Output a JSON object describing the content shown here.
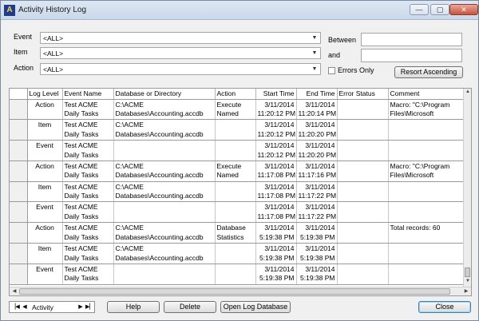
{
  "window": {
    "title": "Activity History Log",
    "icon": "access-app-icon",
    "controls": {
      "minimize": "—",
      "maximize": "▢",
      "close": "✕"
    }
  },
  "filters": {
    "event_label": "Event",
    "item_label": "Item",
    "action_label": "Action",
    "event_value": "<ALL>",
    "item_value": "<ALL>",
    "action_value": "<ALL>",
    "between_label": "Between",
    "and_label": "and",
    "between_value": "",
    "and_value": "",
    "errors_only_label": "Errors Only",
    "errors_only_checked": false,
    "resort_button": "Resort Ascending"
  },
  "table": {
    "columns": [
      "Log Level",
      "Event Name",
      "Database or Directory",
      "Action",
      "Start Time",
      "End Time",
      "Error Status",
      "Comment"
    ],
    "rows": [
      {
        "level": "Action",
        "event1": "Test ACME",
        "event2": "Daily Tasks",
        "db1": "C:\\ACME",
        "db2": "Databases\\Accounting.accdb",
        "action1": "Execute",
        "action2": "Named",
        "start1": "3/11/2014",
        "start2": "11:20:12 PM",
        "end1": "3/11/2014",
        "end2": "11:20:14 PM",
        "error": "",
        "comment1": "Macro: \"C:\\Program",
        "comment2": "Files\\Microsoft"
      },
      {
        "level": "Item",
        "event1": "Test ACME",
        "event2": "Daily Tasks",
        "db1": "C:\\ACME",
        "db2": "Databases\\Accounting.accdb",
        "action1": "",
        "action2": "",
        "start1": "3/11/2014",
        "start2": "11:20:12 PM",
        "end1": "3/11/2014",
        "end2": "11:20:20 PM",
        "error": "",
        "comment1": "",
        "comment2": ""
      },
      {
        "level": "Event",
        "event1": "Test ACME",
        "event2": "Daily Tasks",
        "db1": "",
        "db2": "",
        "action1": "",
        "action2": "",
        "start1": "3/11/2014",
        "start2": "11:20:12 PM",
        "end1": "3/11/2014",
        "end2": "11:20:20 PM",
        "error": "",
        "comment1": "",
        "comment2": ""
      },
      {
        "level": "Action",
        "event1": "Test ACME",
        "event2": "Daily Tasks",
        "db1": "C:\\ACME",
        "db2": "Databases\\Accounting.accdb",
        "action1": "Execute",
        "action2": "Named",
        "start1": "3/11/2014",
        "start2": "11:17:08 PM",
        "end1": "3/11/2014",
        "end2": "11:17:16 PM",
        "error": "",
        "comment1": "Macro: \"C:\\Program",
        "comment2": "Files\\Microsoft"
      },
      {
        "level": "Item",
        "event1": "Test ACME",
        "event2": "Daily Tasks",
        "db1": "C:\\ACME",
        "db2": "Databases\\Accounting.accdb",
        "action1": "",
        "action2": "",
        "start1": "3/11/2014",
        "start2": "11:17:08 PM",
        "end1": "3/11/2014",
        "end2": "11:17:22 PM",
        "error": "",
        "comment1": "",
        "comment2": ""
      },
      {
        "level": "Event",
        "event1": "Test ACME",
        "event2": "Daily Tasks",
        "db1": "",
        "db2": "",
        "action1": "",
        "action2": "",
        "start1": "3/11/2014",
        "start2": "11:17:08 PM",
        "end1": "3/11/2014",
        "end2": "11:17:22 PM",
        "error": "",
        "comment1": "",
        "comment2": ""
      },
      {
        "level": "Action",
        "event1": "Test ACME",
        "event2": "Daily Tasks",
        "db1": "C:\\ACME",
        "db2": "Databases\\Accounting.accdb",
        "action1": "Database",
        "action2": "Statistics",
        "start1": "3/11/2014",
        "start2": "5:19:38 PM",
        "end1": "3/11/2014",
        "end2": "5:19:38 PM",
        "error": "",
        "comment1": "Total records: 60",
        "comment2": ""
      },
      {
        "level": "Item",
        "event1": "Test ACME",
        "event2": "Daily Tasks",
        "db1": "C:\\ACME",
        "db2": "Databases\\Accounting.accdb",
        "action1": "",
        "action2": "",
        "start1": "3/11/2014",
        "start2": "5:19:38 PM",
        "end1": "3/11/2014",
        "end2": "5:19:38 PM",
        "error": "",
        "comment1": "",
        "comment2": ""
      },
      {
        "level": "Event",
        "event1": "Test ACME",
        "event2": "Daily Tasks",
        "db1": "",
        "db2": "",
        "action1": "",
        "action2": "",
        "start1": "3/11/2014",
        "start2": "5:19:38 PM",
        "end1": "3/11/2014",
        "end2": "5:19:38 PM",
        "error": "",
        "comment1": "",
        "comment2": ""
      }
    ]
  },
  "footer": {
    "record_nav_label": "Activity",
    "help_button": "Help",
    "delete_button": "Delete",
    "open_log_button": "Open Log Database",
    "close_button": "Close"
  },
  "icons": {
    "first": "▕◀",
    "prev": "◀",
    "next": "▶",
    "last": "▶▏",
    "dropdown": "▼",
    "scroll_up": "▲",
    "scroll_down": "▼",
    "scroll_left": "◀",
    "scroll_right": "▶"
  }
}
